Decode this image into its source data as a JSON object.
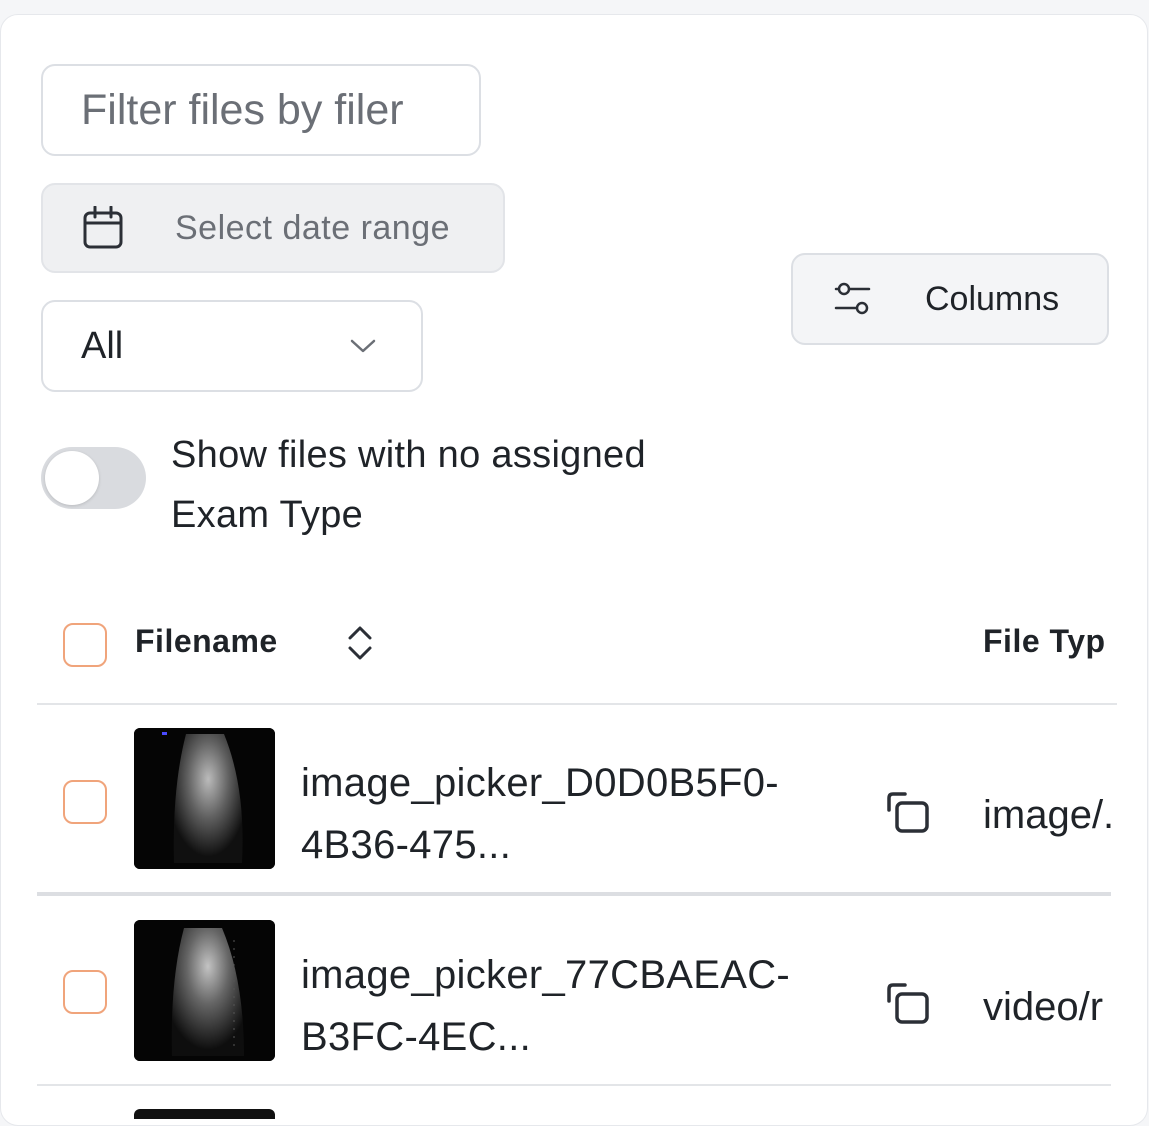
{
  "filters": {
    "search_placeholder": "Filter files by filer",
    "date_range_label": "Select date range",
    "type_select_value": "All",
    "columns_label": "Columns",
    "toggle_label": "Show files with no assigned Exam Type"
  },
  "table": {
    "headers": {
      "filename": "Filename",
      "file_type": "File Typ"
    },
    "rows": [
      {
        "filename_line1": "image_picker_D0D0B5F0-",
        "filename_line2": "4B36-475...",
        "file_type": "image/."
      },
      {
        "filename_line1": "image_picker_77CBAEAC-",
        "filename_line2": "B3FC-4EC...",
        "file_type": "video/r"
      }
    ]
  },
  "icons": {
    "date": "calendar-icon",
    "columns": "sliders-icon",
    "select": "chevron-down-icon",
    "sort": "sort-icon",
    "copy": "copy-icon"
  },
  "colors": {
    "checkbox_border": "#f0a47b",
    "toggle_off": "#d9dbdf",
    "text": "#1f2328",
    "muted": "#6b6f76"
  }
}
